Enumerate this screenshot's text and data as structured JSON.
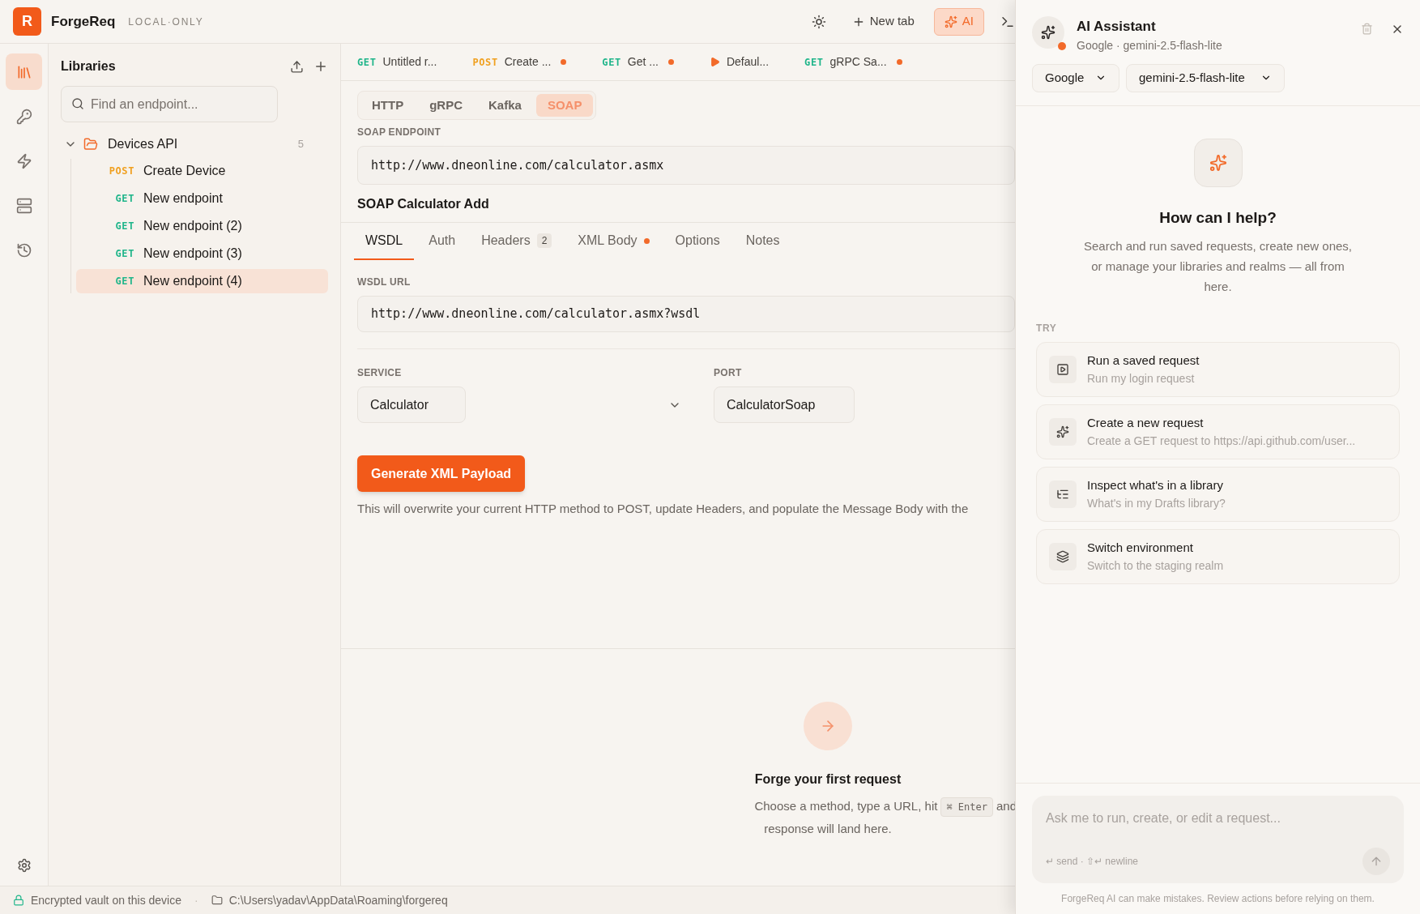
{
  "app": {
    "logo_letter": "R",
    "name": "ForgeReq",
    "badge": "LOCAL·ONLY"
  },
  "toolbar": {
    "new_tab": "New tab",
    "ai": {
      "label": "AI",
      "selected": true
    }
  },
  "rail": [
    {
      "kind": "library",
      "selected": true
    },
    {
      "kind": "key",
      "selected": false
    },
    {
      "kind": "bolt",
      "selected": false
    },
    {
      "kind": "server",
      "selected": false
    },
    {
      "kind": "history",
      "selected": false
    }
  ],
  "libraries": {
    "title": "Libraries",
    "search_placeholder": "Find an endpoint...",
    "folders": [
      {
        "name": "Devices API",
        "count": "5",
        "expanded": true,
        "children": [
          {
            "method": "POST",
            "name": "Create Device",
            "selected": false
          },
          {
            "method": "GET",
            "name": "New endpoint",
            "selected": false
          },
          {
            "method": "GET",
            "name": "New endpoint (2)",
            "selected": false
          },
          {
            "method": "GET",
            "name": "New endpoint (3)",
            "selected": false
          },
          {
            "method": "GET",
            "name": "New endpoint (4)",
            "selected": true
          }
        ]
      }
    ]
  },
  "request_tabs": [
    {
      "kind": "method",
      "method": "GET",
      "title": "Untitled r...",
      "dirty": false
    },
    {
      "kind": "method",
      "method": "POST",
      "title": "Create ...",
      "dirty": true
    },
    {
      "kind": "method",
      "method": "GET",
      "title": "Get ...",
      "dirty": true
    },
    {
      "kind": "play",
      "title": "Defaul...",
      "dirty": false
    },
    {
      "kind": "method",
      "method": "GET",
      "title": "gRPC Sa...",
      "dirty": true
    }
  ],
  "protocols": [
    {
      "label": "HTTP",
      "selected": false
    },
    {
      "label": "gRPC",
      "selected": false
    },
    {
      "label": "Kafka",
      "selected": false
    },
    {
      "label": "SOAP",
      "selected": true
    }
  ],
  "request": {
    "endpoint_label": "SOAP ENDPOINT",
    "endpoint": "http://www.dneonline.com/calculator.asmx",
    "name": "SOAP Calculator Add",
    "tabs": [
      {
        "label": "WSDL",
        "selected": true
      },
      {
        "label": "Auth",
        "selected": false
      },
      {
        "label": "Headers",
        "selected": false,
        "badge": "2"
      },
      {
        "label": "XML Body",
        "selected": false,
        "dot": true
      },
      {
        "label": "Options",
        "selected": false
      },
      {
        "label": "Notes",
        "selected": false
      }
    ],
    "wsdl_label": "WSDL URL",
    "wsdl_url": "http://www.dneonline.com/calculator.asmx?wsdl",
    "service_label": "SERVICE",
    "service": "Calculator",
    "port_label": "PORT",
    "port": "CalculatorSoap",
    "generate_button": "Generate XML Payload",
    "hint": "This will overwrite your current HTTP method to POST, update Headers, and populate the Message Body with the"
  },
  "response_empty": {
    "title": "Forge your first request",
    "text_before": "Choose a method, type a URL, hit",
    "shortcut": "⌘ Enter",
    "text_after": "and",
    "text_line2": "response will land here."
  },
  "status_bar": {
    "vault": "Encrypted vault on this device",
    "separator": "·",
    "path": "C:\\Users\\yadav\\AppData\\Roaming\\forgereq"
  },
  "assistant": {
    "title": "AI Assistant",
    "subtitle": "Google · gemini-2.5-flash-lite",
    "online": true,
    "provider": "Google",
    "model": "gemini-2.5-flash-lite",
    "heading": "How can I help?",
    "description": "Search and run saved requests, create new ones, or manage your libraries and realms — all from here.",
    "try_label": "TRY",
    "suggestions": [
      {
        "kind": "run",
        "title": "Run a saved request",
        "prompt": "Run my login request"
      },
      {
        "kind": "create",
        "title": "Create a new request",
        "prompt": "Create a GET request to https://api.github.com/user..."
      },
      {
        "kind": "inspect",
        "title": "Inspect what's in a library",
        "prompt": "What's in my Drafts library?"
      },
      {
        "kind": "environment",
        "title": "Switch environment",
        "prompt": "Switch to the staging realm"
      }
    ],
    "input_placeholder": "Ask me to run, create, or edit a request...",
    "input_hint": "↵ send · ⇧↵ newline",
    "disclaimer": "ForgeReq AI can make mistakes. Review actions before relying on them."
  }
}
